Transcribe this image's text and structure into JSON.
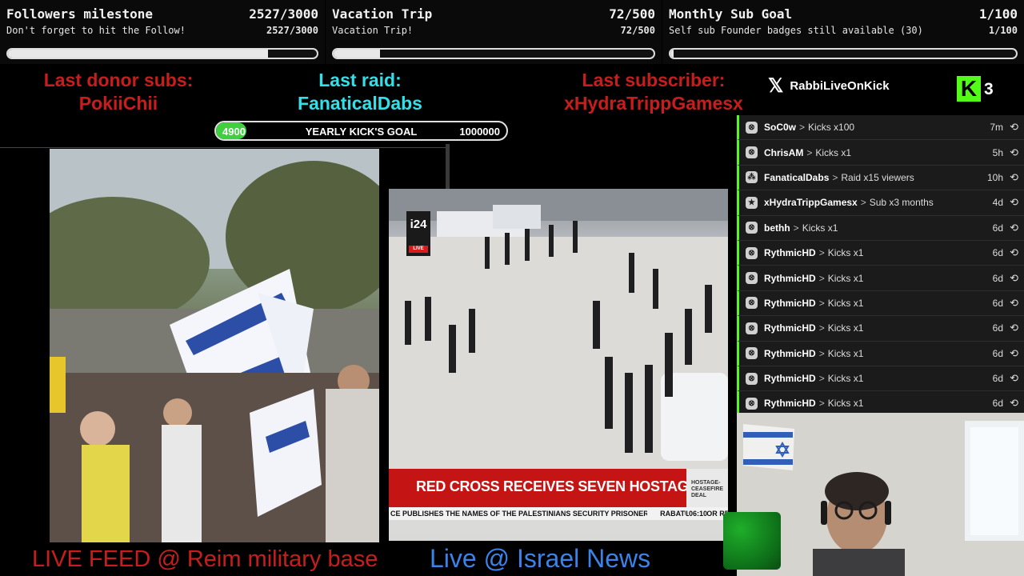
{
  "goals": [
    {
      "title": "Followers milestone",
      "subtitle": "Don't forget to hit the Follow!",
      "value": "2527/3000",
      "value2": "2527/3000",
      "progress": 0.842
    },
    {
      "title": "Vacation Trip",
      "subtitle": "Vacation Trip!",
      "value": "72/500",
      "value2": "72/500",
      "progress": 0.144
    },
    {
      "title": "Monthly Sub Goal",
      "subtitle": "Self sub Founder badges still available (30)",
      "value": "1/100",
      "value2": "1/100",
      "progress": 0.01
    }
  ],
  "last": {
    "donor_label": "Last donor subs:",
    "donor_name": "PokiiChii",
    "raid_label": "Last raid:",
    "raid_name": "FanaticalDabs",
    "sub_label": "Last subscriber:",
    "sub_name": "xHydraTrippGamesx"
  },
  "yearly": {
    "label": "YEARLY KICK'S GOAL",
    "current": "4900",
    "max": "1000000",
    "progress": 0.0049
  },
  "feeds": {
    "left_caption": "LIVE FEED @ Reim military base",
    "right_caption": "Live @ Israel News",
    "chyron_main": "RED CROSS RECEIVES SEVEN HOSTAGES",
    "chyron_tag": "HOSTAGE- CEASEFIRE DEAL",
    "chyron_sub": "CE PUBLISHES THE NAMES OF THE PALESTINIANS SECURITY PRISONERS SCHEDULED FOR RELEASE TODAY",
    "chyron_city": "RABAT",
    "chyron_time": "06:10",
    "channel_logo": "i24",
    "channel_live": "LIVE"
  },
  "brand": {
    "handle": "RabbiLiveOnKick",
    "kick_count": "3",
    "kick_letter": "K"
  },
  "events": [
    {
      "icon": "kick-icon",
      "name": "SoC0w",
      "action": "Kicks x100",
      "time": "7m"
    },
    {
      "icon": "kick-icon",
      "name": "ChrisAM",
      "action": "Kicks x1",
      "time": "5h"
    },
    {
      "icon": "raid-icon",
      "name": "FanaticalDabs",
      "action": "Raid x15 viewers",
      "time": "10h"
    },
    {
      "icon": "star-icon",
      "name": "xHydraTrippGamesx",
      "action": "Sub x3 months",
      "time": "4d"
    },
    {
      "icon": "kick-icon",
      "name": "bethh",
      "action": "Kicks x1",
      "time": "6d"
    },
    {
      "icon": "kick-icon",
      "name": "RythmicHD",
      "action": "Kicks x1",
      "time": "6d"
    },
    {
      "icon": "kick-icon",
      "name": "RythmicHD",
      "action": "Kicks x1",
      "time": "6d"
    },
    {
      "icon": "kick-icon",
      "name": "RythmicHD",
      "action": "Kicks x1",
      "time": "6d"
    },
    {
      "icon": "kick-icon",
      "name": "RythmicHD",
      "action": "Kicks x1",
      "time": "6d"
    },
    {
      "icon": "kick-icon",
      "name": "RythmicHD",
      "action": "Kicks x1",
      "time": "6d"
    },
    {
      "icon": "kick-icon",
      "name": "RythmicHD",
      "action": "Kicks x1",
      "time": "6d"
    },
    {
      "icon": "kick-icon",
      "name": "RythmicHD",
      "action": "Kicks x1",
      "time": "6d"
    }
  ],
  "colors": {
    "kick_green": "#53fc18",
    "last_red": "#c91d1d",
    "last_cyan": "#31e0e8",
    "news_red": "#c41414"
  }
}
